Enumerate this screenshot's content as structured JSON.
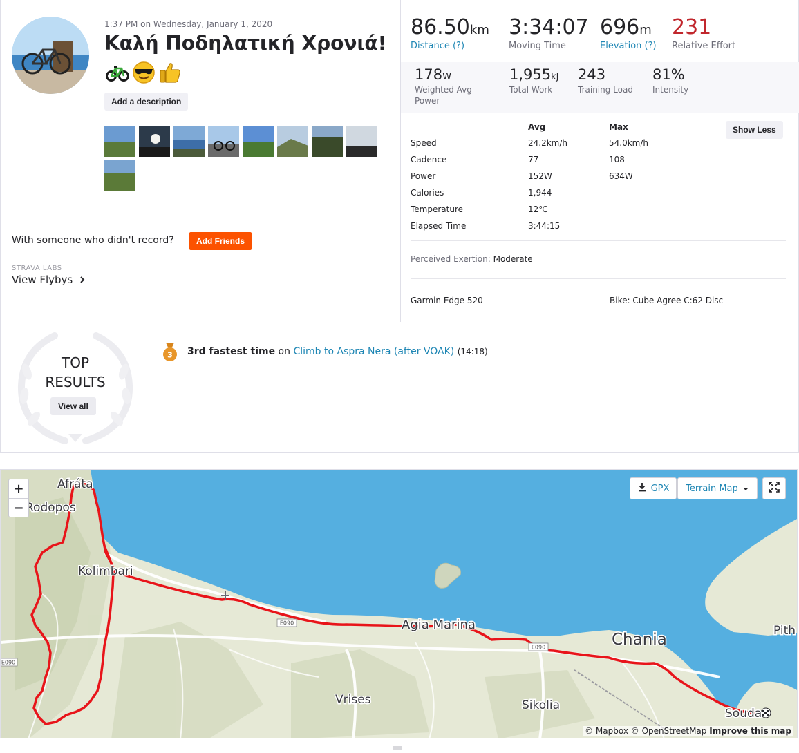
{
  "activity": {
    "timestamp": "1:37 PM on Wednesday, January 1, 2020",
    "title": "Καλή Ποδηλατική Χρονιά!",
    "add_description": "Add a description",
    "photo_count": 9
  },
  "social": {
    "with_someone": "With someone who didn't record?",
    "add_friends": "Add Friends",
    "labs_label": "STRAVA LABS",
    "flybys": "View Flybys"
  },
  "primary_stats": [
    {
      "value": "86.50",
      "unit": "km",
      "label": "Distance (?)"
    },
    {
      "value": "3:34:07",
      "unit": "",
      "label": "Moving Time"
    },
    {
      "value": "696",
      "unit": "m",
      "label": "Elevation (?)"
    },
    {
      "value": "231",
      "unit": "",
      "label": "Relative Effort"
    }
  ],
  "secondary_stats": [
    {
      "value": "178",
      "unit": "W",
      "label": "Weighted Avg Power"
    },
    {
      "value": "1,955",
      "unit": "kJ",
      "label": "Total Work"
    },
    {
      "value": "243",
      "unit": "",
      "label": "Training Load"
    },
    {
      "value": "81%",
      "unit": "",
      "label": "Intensity"
    }
  ],
  "details": {
    "col_avg": "Avg",
    "col_max": "Max",
    "show_less": "Show Less",
    "rows": [
      {
        "label": "Speed",
        "avg": "24.2km/h",
        "max": "54.0km/h"
      },
      {
        "label": "Cadence",
        "avg": "77",
        "max": "108"
      },
      {
        "label": "Power",
        "avg": "152W",
        "max": "634W"
      },
      {
        "label": "Calories",
        "avg": "1,944",
        "max": ""
      },
      {
        "label": "Temperature",
        "avg": "12℃",
        "max": ""
      },
      {
        "label": "Elapsed Time",
        "avg": "3:44:15",
        "max": ""
      }
    ],
    "exertion_label": "Perceived Exertion:",
    "exertion_value": "Moderate",
    "device": "Garmin Edge 520",
    "bike": "Bike: Cube Agree C:62 Disc"
  },
  "results": {
    "title_line1": "TOP",
    "title_line2": "RESULTS",
    "view_all": "View all",
    "medal_rank": "3",
    "achievement_bold": "3rd fastest time",
    "achievement_on": "on",
    "segment": "Climb to Aspra Nera (after VOAK)",
    "segment_time": "(14:18)"
  },
  "map": {
    "zoom_in": "+",
    "zoom_out": "−",
    "gpx": "GPX",
    "map_type": "Terrain Map",
    "attribution_1": "© Mapbox © OpenStreetMap",
    "attribution_2": "Improve this map",
    "places": {
      "afrata": "Afráta",
      "rodopos": "Rodopos",
      "kolimbari": "Kolimbari",
      "agia_marina": "Agia Marina",
      "chania": "Chania",
      "pith": "Pith",
      "vrises": "Vrises",
      "sikolia": "Sikolia",
      "souda": "Souda",
      "road1": "E090",
      "road2": "E090",
      "road3": "E090"
    },
    "colors": {
      "sea": "#55afe0",
      "land": "#e7ead8",
      "route": "#e8141a"
    }
  }
}
